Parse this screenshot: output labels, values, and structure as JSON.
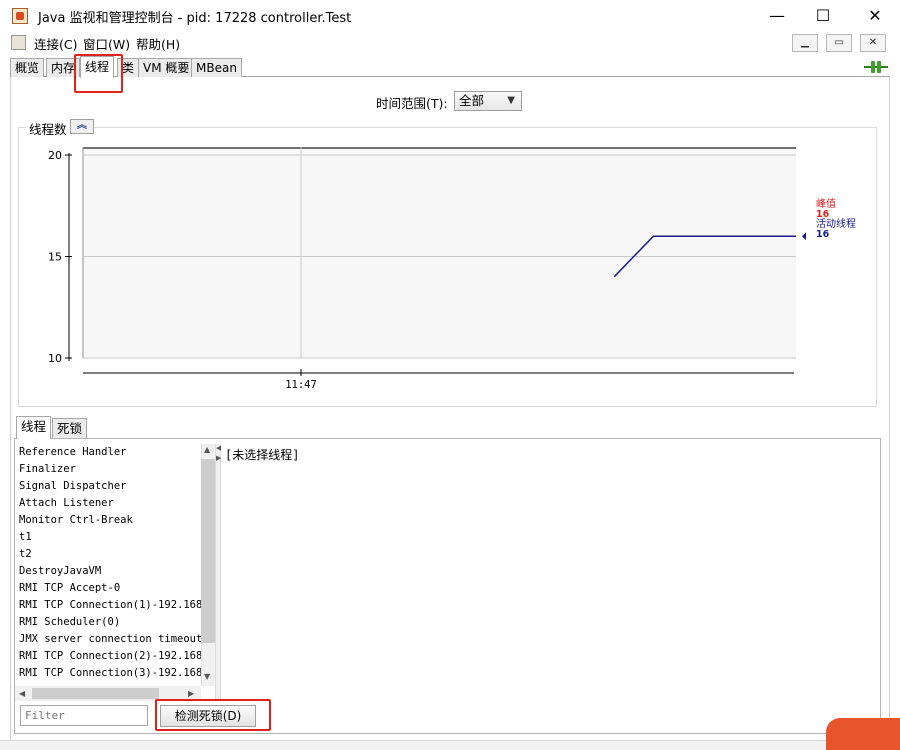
{
  "window": {
    "title": "Java 监视和管理控制台 - pid: 17228 controller.Test",
    "minimize": "—",
    "maximize": "☐",
    "close": "✕"
  },
  "menu": {
    "items": [
      "连接(C)",
      "窗口(W)",
      "帮助(H)"
    ],
    "inner_minimize": "▁",
    "inner_restore": "▭",
    "inner_close": "✕"
  },
  "tabs": [
    "概览",
    "内存",
    "线程",
    "类",
    "VM 概要",
    "MBean"
  ],
  "selected_tab": "线程",
  "time_range": {
    "label": "时间范围(T):",
    "value": "全部"
  },
  "chart_panel": {
    "title": "线程数"
  },
  "chart_data": {
    "type": "line",
    "title": "",
    "xlabel": "",
    "ylabel": "",
    "ylim": [
      10,
      20
    ],
    "yticks": [
      10,
      15,
      20
    ],
    "xticks": [
      "11:47"
    ],
    "grid": true,
    "series": [
      {
        "name": "活动线程",
        "color": "#1a1a8c",
        "points": [
          [
            0.745,
            14
          ],
          [
            0.8,
            16
          ],
          [
            1.0,
            16
          ]
        ]
      }
    ],
    "legend": [
      {
        "label": "峰值",
        "value": "16",
        "color": "#e0211c"
      },
      {
        "label": "活动线程",
        "value": "16",
        "color": "#1a1a8c"
      }
    ]
  },
  "subtabs": [
    "线程",
    "死锁"
  ],
  "threads": [
    "Reference Handler",
    "Finalizer",
    "Signal Dispatcher",
    "Attach Listener",
    "Monitor Ctrl-Break",
    "t1",
    "t2",
    "DestroyJavaVM",
    "RMI TCP Accept-0",
    "RMI TCP Connection(1)-192.168.",
    "RMI Scheduler(0)",
    "JMX server connection timeout",
    "RMI TCP Connection(2)-192.168.",
    "RMI TCP Connection(3)-192.168."
  ],
  "detail": {
    "text": "[未选择线程]"
  },
  "filter": {
    "placeholder": "Filter"
  },
  "deadlock_button": {
    "label": "检测死锁(D)"
  },
  "colors": {
    "highlight": "#e0211c",
    "peak": "#e0211c",
    "live": "#1a1a8c"
  }
}
